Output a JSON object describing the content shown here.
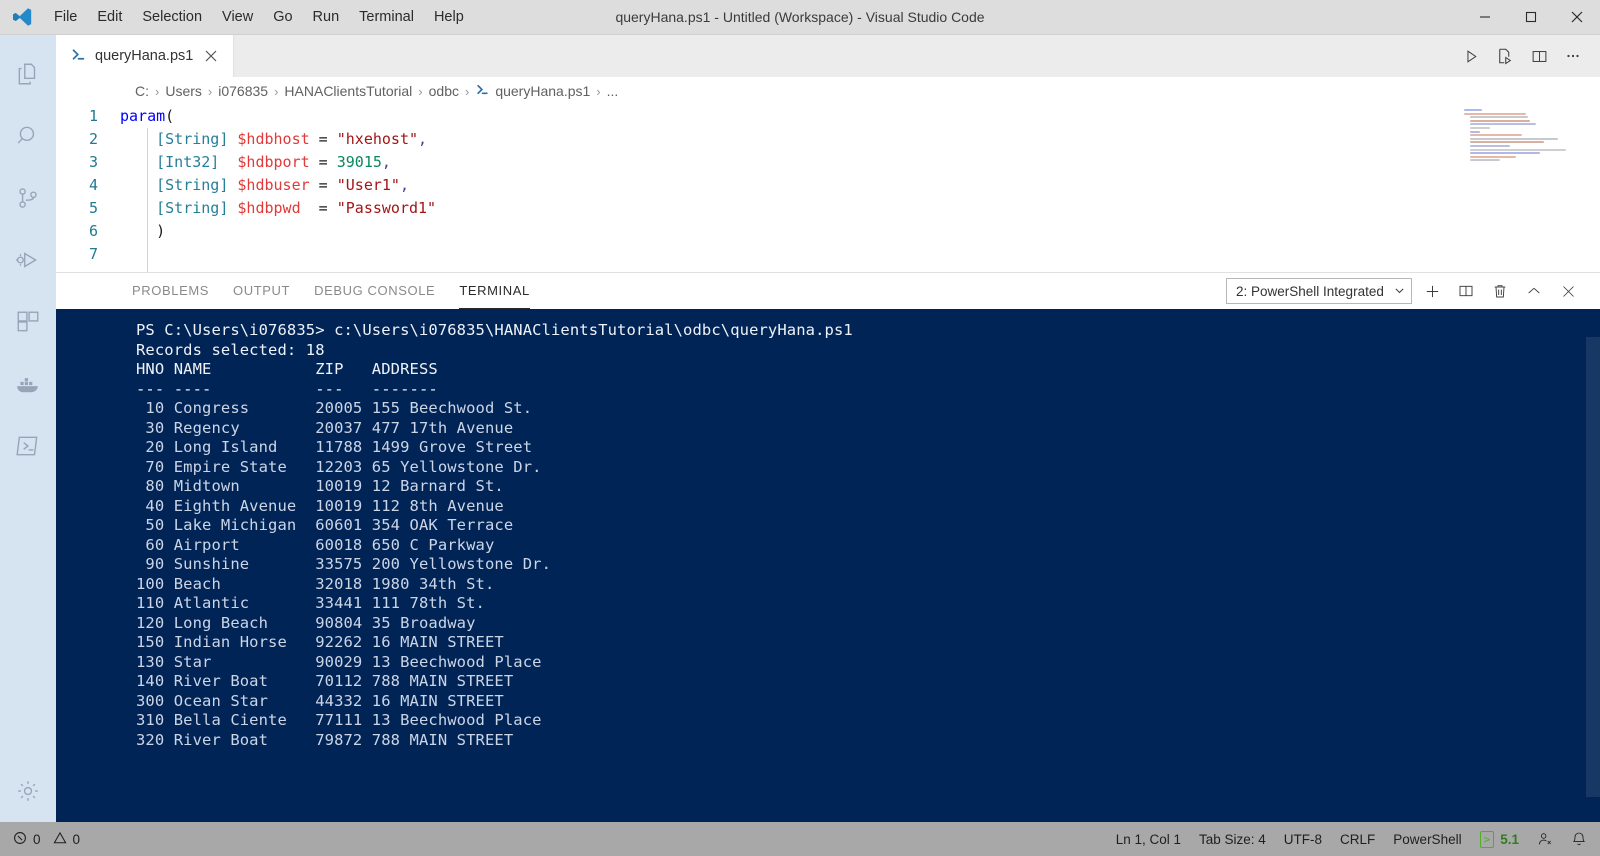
{
  "titlebar": {
    "title": "queryHana.ps1 - Untitled (Workspace) - Visual Studio Code",
    "menus": [
      "File",
      "Edit",
      "Selection",
      "View",
      "Go",
      "Run",
      "Terminal",
      "Help"
    ],
    "window_controls": [
      "minimize",
      "restore",
      "close"
    ]
  },
  "activitybar": {
    "items": [
      {
        "name": "explorer",
        "icon": "files-icon"
      },
      {
        "name": "search",
        "icon": "search-icon"
      },
      {
        "name": "source-control",
        "icon": "source-control-icon"
      },
      {
        "name": "run-and-debug",
        "icon": "run-debug-icon"
      },
      {
        "name": "extensions",
        "icon": "extensions-icon"
      },
      {
        "name": "docker",
        "icon": "docker-icon"
      },
      {
        "name": "powershell",
        "icon": "powershell-icon"
      }
    ],
    "bottom": [
      {
        "name": "manage",
        "icon": "gear-icon"
      }
    ]
  },
  "tabs": {
    "open": [
      {
        "label": "queryHana.ps1",
        "icon": "powershell-file-icon",
        "active": true,
        "close": "×"
      }
    ],
    "editor_actions": [
      {
        "name": "run-file",
        "icon": "play-icon"
      },
      {
        "name": "run-file-in-terminal",
        "icon": "run-file-icon"
      },
      {
        "name": "split-editor",
        "icon": "split-editor-icon"
      },
      {
        "name": "more-actions",
        "icon": "ellipsis-icon"
      }
    ]
  },
  "breadcrumb": {
    "separator": "›",
    "items": [
      "C:",
      "Users",
      "i076835",
      "HANAClientsTutorial",
      "odbc",
      "queryHana.ps1",
      "..."
    ],
    "file_index": 5
  },
  "editor": {
    "line_numbers": [
      "1",
      "2",
      "3",
      "4",
      "5",
      "6",
      "7"
    ],
    "lines": [
      [
        {
          "t": "kw",
          "s": "param"
        },
        {
          "t": "plain",
          "s": "("
        }
      ],
      [
        {
          "t": "plain",
          "s": "    "
        },
        {
          "t": "type",
          "s": "[String]"
        },
        {
          "t": "plain",
          "s": " "
        },
        {
          "t": "var",
          "s": "$hdbhost"
        },
        {
          "t": "plain",
          "s": " = "
        },
        {
          "t": "str",
          "s": "\"hxehost\""
        },
        {
          "t": "punc",
          "s": ","
        }
      ],
      [
        {
          "t": "plain",
          "s": "    "
        },
        {
          "t": "type",
          "s": "[Int32]"
        },
        {
          "t": "plain",
          "s": "  "
        },
        {
          "t": "var",
          "s": "$hdbport"
        },
        {
          "t": "plain",
          "s": " = "
        },
        {
          "t": "num",
          "s": "39015"
        },
        {
          "t": "punc",
          "s": ","
        }
      ],
      [
        {
          "t": "plain",
          "s": "    "
        },
        {
          "t": "type",
          "s": "[String]"
        },
        {
          "t": "plain",
          "s": " "
        },
        {
          "t": "var",
          "s": "$hdbuser"
        },
        {
          "t": "plain",
          "s": " = "
        },
        {
          "t": "str",
          "s": "\"User1\""
        },
        {
          "t": "punc",
          "s": ","
        }
      ],
      [
        {
          "t": "plain",
          "s": "    "
        },
        {
          "t": "type",
          "s": "[String]"
        },
        {
          "t": "plain",
          "s": " "
        },
        {
          "t": "var",
          "s": "$hdbpwd"
        },
        {
          "t": "plain",
          "s": "  = "
        },
        {
          "t": "str",
          "s": "\"Password1\""
        }
      ],
      [
        {
          "t": "plain",
          "s": "    )"
        }
      ]
    ]
  },
  "panel": {
    "tabs": [
      {
        "label": "PROBLEMS",
        "active": false
      },
      {
        "label": "OUTPUT",
        "active": false
      },
      {
        "label": "DEBUG CONSOLE",
        "active": false
      },
      {
        "label": "TERMINAL",
        "active": true
      }
    ],
    "terminal_select": {
      "value": "2: PowerShell Integrated",
      "chevron": "⌄"
    },
    "actions": [
      {
        "name": "new-terminal",
        "icon": "plus-icon"
      },
      {
        "name": "split-terminal",
        "icon": "split-icon"
      },
      {
        "name": "kill-terminal",
        "icon": "trash-icon"
      },
      {
        "name": "hide-panel",
        "icon": "chevron-up-icon"
      },
      {
        "name": "close-panel",
        "icon": "close-icon"
      }
    ]
  },
  "terminal": {
    "prompt_line": "PS C:\\Users\\i076835> c:\\Users\\i076835\\HANAClientsTutorial\\odbc\\queryHana.ps1",
    "records_line": "Records selected: 18",
    "blank": "",
    "header": "HNO NAME           ZIP   ADDRESS",
    "rule": "--- ----           ---   -------",
    "rows": [
      " 10 Congress       20005 155 Beechwood St.",
      " 30 Regency        20037 477 17th Avenue",
      " 20 Long Island    11788 1499 Grove Street",
      " 70 Empire State   12203 65 Yellowstone Dr.",
      " 80 Midtown        10019 12 Barnard St.",
      " 40 Eighth Avenue  10019 112 8th Avenue",
      " 50 Lake Michigan  60601 354 OAK Terrace",
      " 60 Airport        60018 650 C Parkway",
      " 90 Sunshine       33575 200 Yellowstone Dr.",
      "100 Beach          32018 1980 34th St.",
      "110 Atlantic       33441 111 78th St.",
      "120 Long Beach     90804 35 Broadway",
      "150 Indian Horse   92262 16 MAIN STREET",
      "130 Star           90029 13 Beechwood Place",
      "140 River Boat     70112 788 MAIN STREET",
      "300 Ocean Star     44332 16 MAIN STREET",
      "310 Bella Ciente   77111 13 Beechwood Place",
      "320 River Boat     79872 788 MAIN STREET"
    ],
    "background_color": "#012456",
    "text_color": "#ccd5e6"
  },
  "statusbar": {
    "errors": "0",
    "warnings": "0",
    "cursor_position": "Ln 1, Col 1",
    "tab_size": "Tab Size: 4",
    "encoding": "UTF-8",
    "eol": "CRLF",
    "language": "PowerShell",
    "ps_version": "5.1",
    "accent_green": "#4caf2a",
    "right_icons": [
      {
        "name": "remote-account-icon"
      },
      {
        "name": "bell-icon"
      }
    ]
  }
}
